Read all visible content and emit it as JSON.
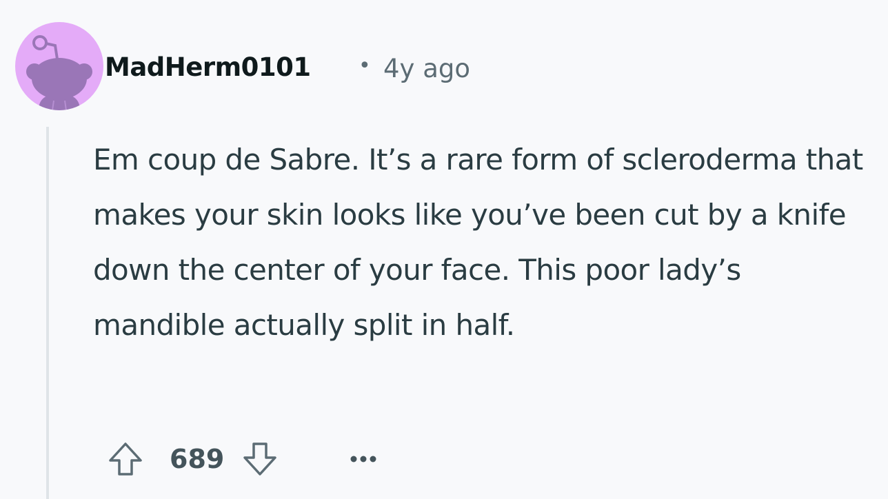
{
  "comment": {
    "author": "MadHerm0101",
    "separator": "•",
    "timestamp": "4y ago",
    "body": "Em coup de Sabre. It’s a rare form of scleroderma that makes your skin looks like you’ve been cut by a knife down the center of your face. This poor lady’s mandible actually split in half.",
    "score": "689"
  },
  "icons": {
    "avatar": "snoo-avatar-icon",
    "upvote": "upvote-arrow-icon",
    "downvote": "downvote-arrow-icon",
    "more": "more-options-icon"
  },
  "colors": {
    "background": "#f8f9fb",
    "avatar_bg": "#e4abf8",
    "avatar_figure": "#9a76b7",
    "text": "#2a3c42",
    "meta": "#5c6c74"
  }
}
